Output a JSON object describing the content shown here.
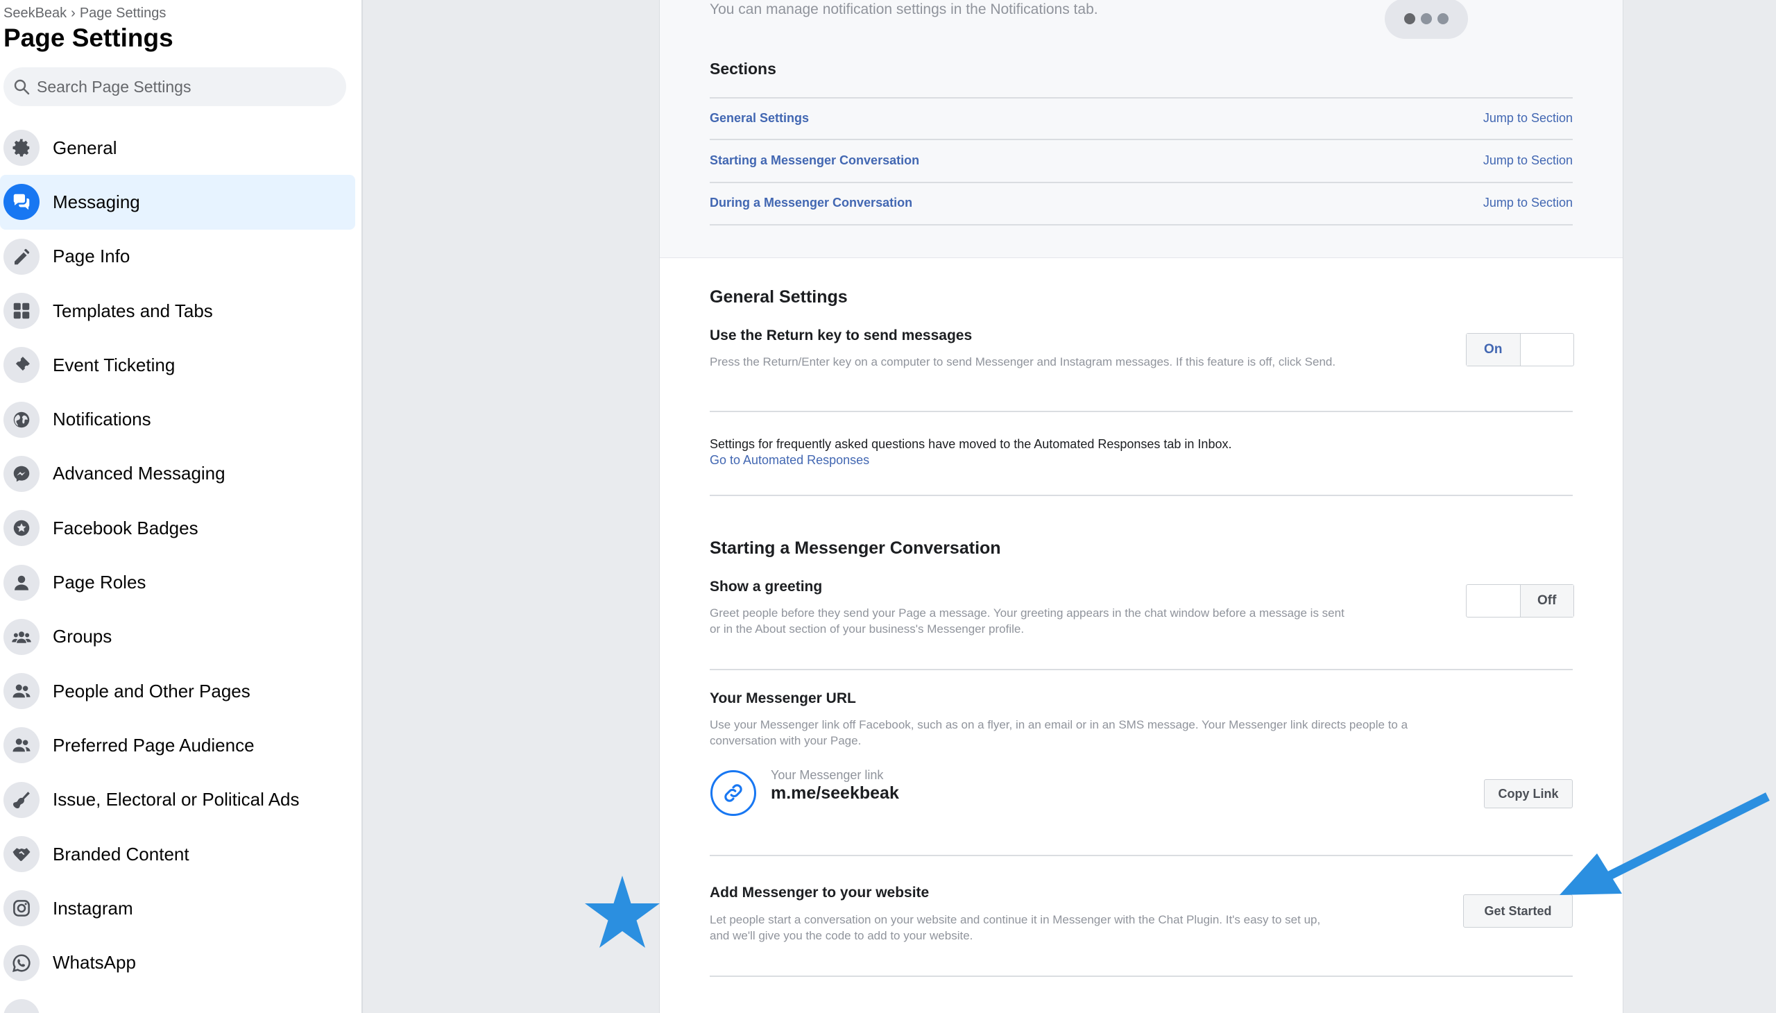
{
  "breadcrumb": {
    "root": "SeekBeak",
    "separator": "›",
    "current": "Page Settings"
  },
  "page_title": "Page Settings",
  "search": {
    "placeholder": "Search Page Settings"
  },
  "nav": [
    {
      "label": "General",
      "icon": "gear-icon"
    },
    {
      "label": "Messaging",
      "icon": "messenger-icon",
      "active": true
    },
    {
      "label": "Page Info",
      "icon": "pencil-icon"
    },
    {
      "label": "Templates and Tabs",
      "icon": "grid-icon"
    },
    {
      "label": "Event Ticketing",
      "icon": "ticket-icon"
    },
    {
      "label": "Notifications",
      "icon": "globe-icon"
    },
    {
      "label": "Advanced Messaging",
      "icon": "messenger-bolt-icon"
    },
    {
      "label": "Facebook Badges",
      "icon": "badge-icon"
    },
    {
      "label": "Page Roles",
      "icon": "person-icon"
    },
    {
      "label": "Groups",
      "icon": "group-icon"
    },
    {
      "label": "People and Other Pages",
      "icon": "people-icon"
    },
    {
      "label": "Preferred Page Audience",
      "icon": "audience-icon"
    },
    {
      "label": "Issue, Electoral or Political Ads",
      "icon": "guitar-icon"
    },
    {
      "label": "Branded Content",
      "icon": "handshake-icon"
    },
    {
      "label": "Instagram",
      "icon": "instagram-icon"
    },
    {
      "label": "WhatsApp",
      "icon": "whatsapp-icon"
    }
  ],
  "top": {
    "note": "You can manage notification settings in the Notifications tab.",
    "sections_title": "Sections",
    "sections": [
      {
        "label": "General Settings",
        "jump": "Jump to Section"
      },
      {
        "label": "Starting a Messenger Conversation",
        "jump": "Jump to Section"
      },
      {
        "label": "During a Messenger Conversation",
        "jump": "Jump to Section"
      }
    ]
  },
  "general": {
    "title": "General Settings",
    "return_key": {
      "title": "Use the Return key to send messages",
      "desc": "Press the Return/Enter key on a computer to send Messenger and Instagram messages. If this feature is off, click Send.",
      "toggle_label": "On"
    },
    "faq_note": "Settings for frequently asked questions have moved to the Automated Responses tab in Inbox.",
    "faq_link": "Go to Automated Responses"
  },
  "starting": {
    "title": "Starting a Messenger Conversation",
    "greeting": {
      "title": "Show a greeting",
      "desc_1": "Greet people before they send your Page a message. Your greeting appears in the chat window before a message is sent",
      "desc_2": "or in the About section of your business's Messenger profile.",
      "toggle_label": "Off"
    },
    "url": {
      "title": "Your Messenger URL",
      "desc_1": "Use your Messenger link off Facebook, such as on a flyer, in an email or in an SMS message. Your Messenger link directs people to a",
      "desc_2": "conversation with your Page.",
      "link_caption": "Your Messenger link",
      "link_value": "m.me/seekbeak",
      "copy_label": "Copy Link"
    },
    "website": {
      "title": "Add Messenger to your website",
      "desc_1": "Let people start a conversation on your website and continue it in Messenger with the Chat Plugin. It's easy to set up,",
      "desc_2": "and we'll give you the code to add to your website.",
      "button_label": "Get Started"
    }
  },
  "annotations": {
    "accent": "#2b8fe0",
    "star": "star-marker",
    "arrow": "arrow-marker"
  }
}
